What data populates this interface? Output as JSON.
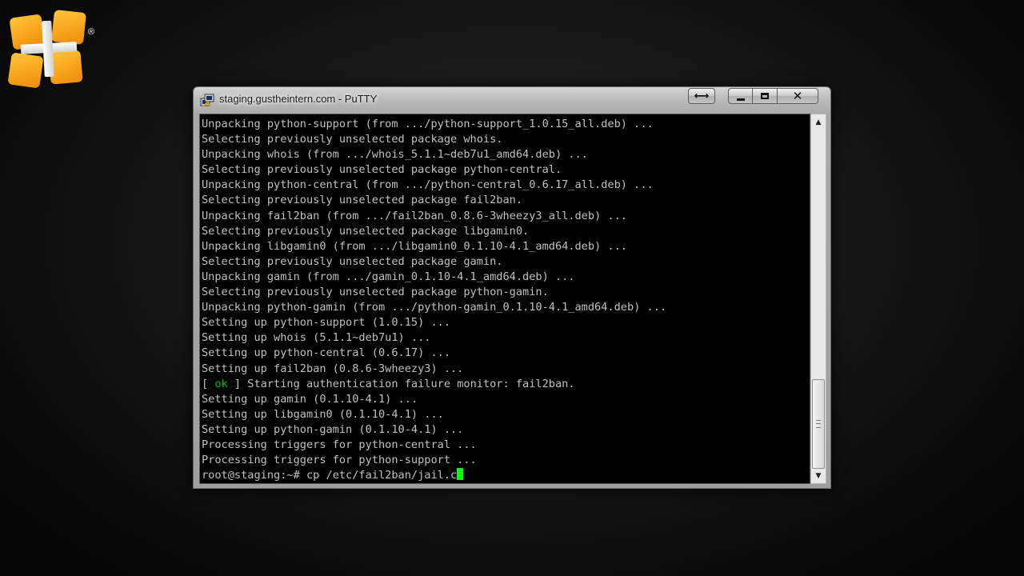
{
  "logo": {
    "registered_mark": "®"
  },
  "window": {
    "title": "staging.gustheintern.com - PuTTY",
    "buttons": {
      "resize": "⟷",
      "close": "✕"
    }
  },
  "terminal": {
    "lines": [
      "Unpacking python-support (from .../python-support_1.0.15_all.deb) ...",
      "Selecting previously unselected package whois.",
      "Unpacking whois (from .../whois_5.1.1~deb7u1_amd64.deb) ...",
      "Selecting previously unselected package python-central.",
      "Unpacking python-central (from .../python-central_0.6.17_all.deb) ...",
      "Selecting previously unselected package fail2ban.",
      "Unpacking fail2ban (from .../fail2ban_0.8.6-3wheezy3_all.deb) ...",
      "Selecting previously unselected package libgamin0.",
      "Unpacking libgamin0 (from .../libgamin0_0.1.10-4.1_amd64.deb) ...",
      "Selecting previously unselected package gamin.",
      "Unpacking gamin (from .../gamin_0.1.10-4.1_amd64.deb) ...",
      "Selecting previously unselected package python-gamin.",
      "Unpacking python-gamin (from .../python-gamin_0.1.10-4.1_amd64.deb) ...",
      "Setting up python-support (1.0.15) ...",
      "Setting up whois (5.1.1~deb7u1) ...",
      "Setting up python-central (0.6.17) ...",
      "Setting up fail2ban (0.8.6-3wheezy3) ..."
    ],
    "status_line": {
      "open": "[ ",
      "ok": "ok",
      "close": " ]",
      "message": " Starting authentication failure monitor: fail2ban."
    },
    "lines_after": [
      "Setting up gamin (0.1.10-4.1) ...",
      "Setting up libgamin0 (0.1.10-4.1) ...",
      "Setting up python-gamin (0.1.10-4.1) ...",
      "Processing triggers for python-central ...",
      "Processing triggers for python-support ..."
    ],
    "prompt": "root@staging:~# ",
    "command": "cp /etc/fail2ban/jail.c"
  },
  "scrollbar": {
    "up_arrow": "▲",
    "down_arrow": "▼"
  },
  "colors": {
    "terminal_bg": "#000000",
    "terminal_text": "#c0c0c0",
    "ok_green": "#00c000",
    "cursor": "#00ff00",
    "logo_orange": "#f7a21b"
  }
}
